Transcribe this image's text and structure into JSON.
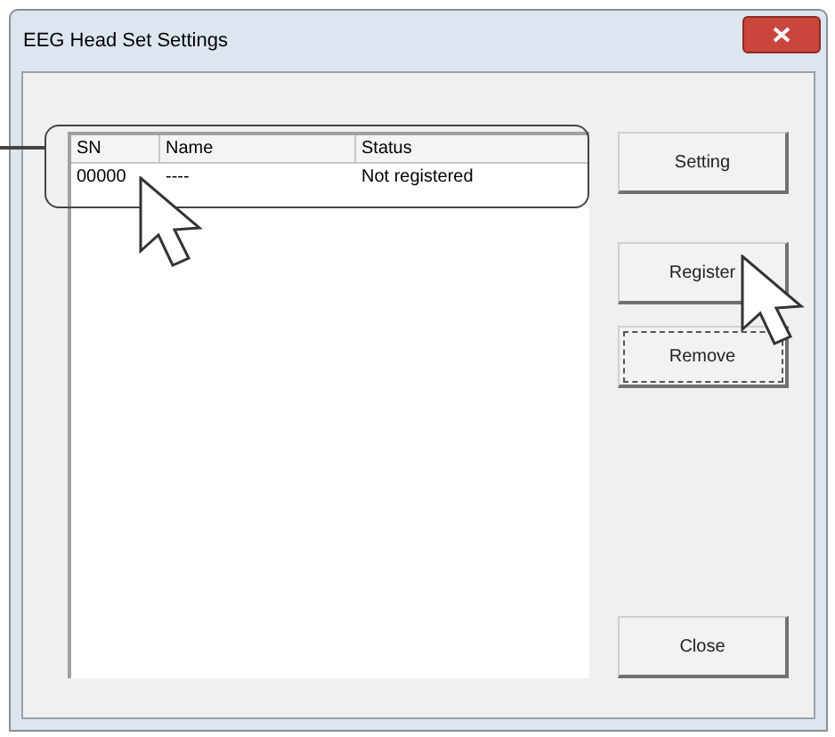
{
  "window": {
    "title": "EEG Head Set Settings"
  },
  "table": {
    "columns": [
      "SN",
      "Name",
      "Status"
    ],
    "rows": [
      [
        "00000",
        "----",
        "Not registered"
      ]
    ]
  },
  "buttons": [
    {
      "label": "Setting",
      "focused": false
    },
    {
      "label": "Register",
      "focused": false
    },
    {
      "label": "Remove",
      "focused": true
    },
    {
      "label": "Close",
      "focused": false
    }
  ]
}
